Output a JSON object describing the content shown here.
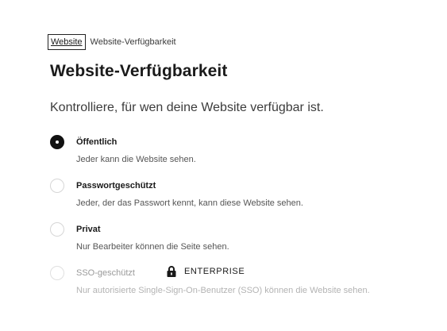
{
  "breadcrumb": {
    "root": "Website",
    "current": "Website-Verfügbarkeit"
  },
  "page": {
    "title": "Website-Verfügbarkeit",
    "subtitle": "Kontrolliere, für wen deine Website verfügbar ist."
  },
  "options": [
    {
      "label": "Öffentlich",
      "description": "Jeder kann die Website sehen.",
      "selected": true
    },
    {
      "label": "Passwortgeschützt",
      "description": "Jeder, der das Passwort kennt, kann diese Website sehen.",
      "selected": false
    },
    {
      "label": "Privat",
      "description": "Nur Bearbeiter können die Seite sehen.",
      "selected": false
    },
    {
      "label": "SSO-geschützt",
      "description": "Nur autorisierte Single-Sign-On-Benutzer (SSO) können die Website sehen.",
      "selected": false,
      "disabled": true,
      "badge_icon": "lock-icon",
      "badge": "ENTERPRISE"
    }
  ]
}
